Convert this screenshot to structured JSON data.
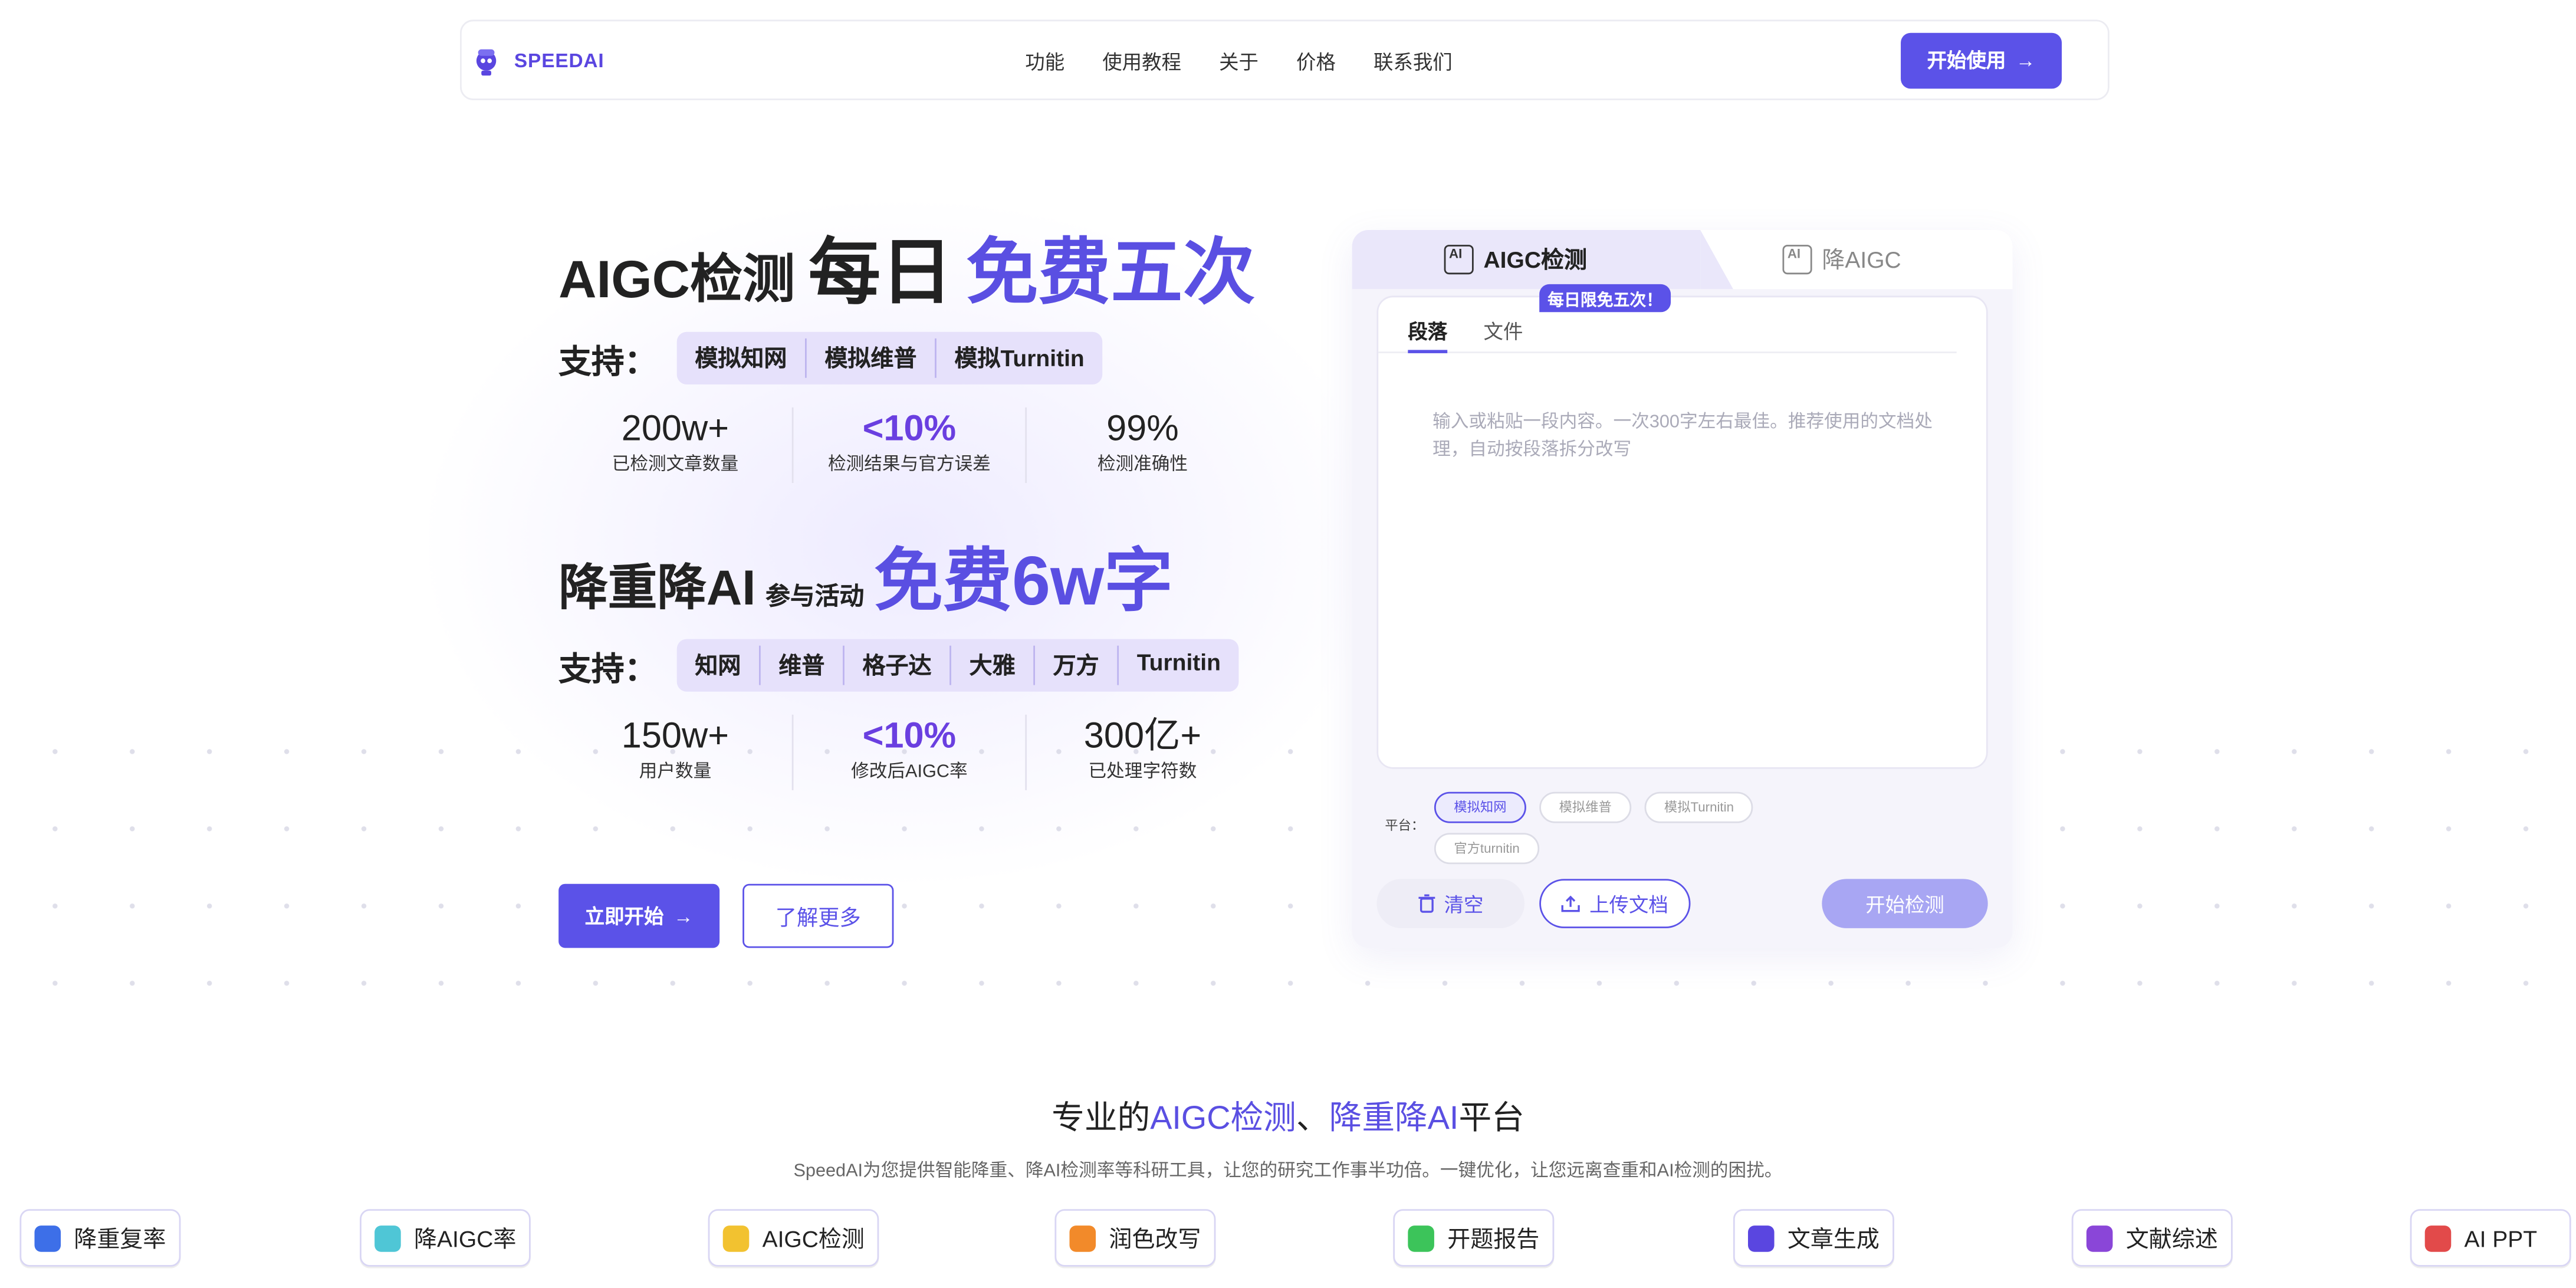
{
  "nav": {
    "brand": "SPEEDAI",
    "links": [
      "功能",
      "使用教程",
      "关于",
      "价格",
      "联系我们"
    ],
    "cta": "开始使用"
  },
  "hero": {
    "line1": {
      "a": "AIGC检测",
      "b": "每日",
      "c": "免费五次"
    },
    "support_label": "支持：",
    "support1": [
      "模拟知网",
      "模拟维普",
      "模拟Turnitin"
    ],
    "stats1": [
      {
        "value": "200w+",
        "label": "已检测文章数量"
      },
      {
        "value": "<10%",
        "label": "检测结果与官方误差"
      },
      {
        "value": "99%",
        "label": "检测准确性"
      }
    ],
    "line2": {
      "a": "降重降AI",
      "b": "参与活动",
      "c": "免费6w字"
    },
    "support2": [
      "知网",
      "维普",
      "格子达",
      "大雅",
      "万方",
      "Turnitin"
    ],
    "stats2": [
      {
        "value": "150w+",
        "label": "用户数量"
      },
      {
        "value": "<10%",
        "label": "修改后AIGC率"
      },
      {
        "value": "300亿+",
        "label": "已处理字符数"
      }
    ],
    "btn_start": "立即开始",
    "btn_more": "了解更多"
  },
  "panel": {
    "tab_active": "AIGC检测",
    "tab_inactive": "降AIGC",
    "subtabs": [
      "段落",
      "文件"
    ],
    "badge": "每日限免五次！",
    "placeholder": "输入或粘贴一段内容。一次300字左右最佳。推荐使用的文档处理，自动按段落拆分改写",
    "platform_label": "平台：",
    "platforms": [
      "模拟知网",
      "模拟维普",
      "模拟Turnitin",
      "官方turnitin"
    ],
    "clear": "清空",
    "upload": "上传文档",
    "start": "开始检测"
  },
  "section": {
    "title_a": "专业的",
    "title_b": "AIGC检测",
    "title_c": "、",
    "title_d": "降重降AI",
    "title_e": "平台",
    "subtitle": "SpeedAI为您提供智能降重、降AI检测率等科研工具，让您的研究工作事半功倍。一键优化，让您远离查重和AI检测的困扰。"
  },
  "features": [
    {
      "label": "降重复率",
      "color": "#3d6fe8"
    },
    {
      "label": "降AIGC率",
      "color": "#4fc6d6"
    },
    {
      "label": "AIGC检测",
      "color": "#f2c230"
    },
    {
      "label": "润色改写",
      "color": "#f28a2a"
    },
    {
      "label": "开题报告",
      "color": "#3cc45a"
    },
    {
      "label": "文章生成",
      "color": "#5a46e0"
    },
    {
      "label": "文献综述",
      "color": "#8a46d8"
    },
    {
      "label": "AI PPT",
      "color": "#e24a4a"
    }
  ]
}
